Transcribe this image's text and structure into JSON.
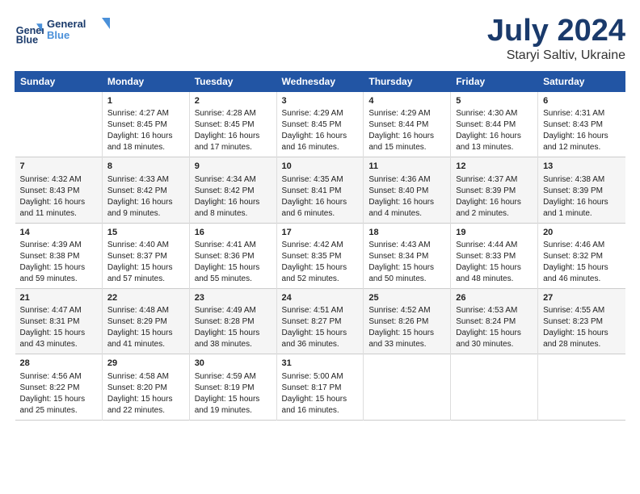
{
  "logo": {
    "line1": "General",
    "line2": "Blue"
  },
  "title": "July 2024",
  "subtitle": "Staryi Saltiv, Ukraine",
  "days_header": [
    "Sunday",
    "Monday",
    "Tuesday",
    "Wednesday",
    "Thursday",
    "Friday",
    "Saturday"
  ],
  "weeks": [
    [
      {
        "day": "",
        "content": ""
      },
      {
        "day": "1",
        "content": "Sunrise: 4:27 AM\nSunset: 8:45 PM\nDaylight: 16 hours\nand 18 minutes."
      },
      {
        "day": "2",
        "content": "Sunrise: 4:28 AM\nSunset: 8:45 PM\nDaylight: 16 hours\nand 17 minutes."
      },
      {
        "day": "3",
        "content": "Sunrise: 4:29 AM\nSunset: 8:45 PM\nDaylight: 16 hours\nand 16 minutes."
      },
      {
        "day": "4",
        "content": "Sunrise: 4:29 AM\nSunset: 8:44 PM\nDaylight: 16 hours\nand 15 minutes."
      },
      {
        "day": "5",
        "content": "Sunrise: 4:30 AM\nSunset: 8:44 PM\nDaylight: 16 hours\nand 13 minutes."
      },
      {
        "day": "6",
        "content": "Sunrise: 4:31 AM\nSunset: 8:43 PM\nDaylight: 16 hours\nand 12 minutes."
      }
    ],
    [
      {
        "day": "7",
        "content": "Sunrise: 4:32 AM\nSunset: 8:43 PM\nDaylight: 16 hours\nand 11 minutes."
      },
      {
        "day": "8",
        "content": "Sunrise: 4:33 AM\nSunset: 8:42 PM\nDaylight: 16 hours\nand 9 minutes."
      },
      {
        "day": "9",
        "content": "Sunrise: 4:34 AM\nSunset: 8:42 PM\nDaylight: 16 hours\nand 8 minutes."
      },
      {
        "day": "10",
        "content": "Sunrise: 4:35 AM\nSunset: 8:41 PM\nDaylight: 16 hours\nand 6 minutes."
      },
      {
        "day": "11",
        "content": "Sunrise: 4:36 AM\nSunset: 8:40 PM\nDaylight: 16 hours\nand 4 minutes."
      },
      {
        "day": "12",
        "content": "Sunrise: 4:37 AM\nSunset: 8:39 PM\nDaylight: 16 hours\nand 2 minutes."
      },
      {
        "day": "13",
        "content": "Sunrise: 4:38 AM\nSunset: 8:39 PM\nDaylight: 16 hours\nand 1 minute."
      }
    ],
    [
      {
        "day": "14",
        "content": "Sunrise: 4:39 AM\nSunset: 8:38 PM\nDaylight: 15 hours\nand 59 minutes."
      },
      {
        "day": "15",
        "content": "Sunrise: 4:40 AM\nSunset: 8:37 PM\nDaylight: 15 hours\nand 57 minutes."
      },
      {
        "day": "16",
        "content": "Sunrise: 4:41 AM\nSunset: 8:36 PM\nDaylight: 15 hours\nand 55 minutes."
      },
      {
        "day": "17",
        "content": "Sunrise: 4:42 AM\nSunset: 8:35 PM\nDaylight: 15 hours\nand 52 minutes."
      },
      {
        "day": "18",
        "content": "Sunrise: 4:43 AM\nSunset: 8:34 PM\nDaylight: 15 hours\nand 50 minutes."
      },
      {
        "day": "19",
        "content": "Sunrise: 4:44 AM\nSunset: 8:33 PM\nDaylight: 15 hours\nand 48 minutes."
      },
      {
        "day": "20",
        "content": "Sunrise: 4:46 AM\nSunset: 8:32 PM\nDaylight: 15 hours\nand 46 minutes."
      }
    ],
    [
      {
        "day": "21",
        "content": "Sunrise: 4:47 AM\nSunset: 8:31 PM\nDaylight: 15 hours\nand 43 minutes."
      },
      {
        "day": "22",
        "content": "Sunrise: 4:48 AM\nSunset: 8:29 PM\nDaylight: 15 hours\nand 41 minutes."
      },
      {
        "day": "23",
        "content": "Sunrise: 4:49 AM\nSunset: 8:28 PM\nDaylight: 15 hours\nand 38 minutes."
      },
      {
        "day": "24",
        "content": "Sunrise: 4:51 AM\nSunset: 8:27 PM\nDaylight: 15 hours\nand 36 minutes."
      },
      {
        "day": "25",
        "content": "Sunrise: 4:52 AM\nSunset: 8:26 PM\nDaylight: 15 hours\nand 33 minutes."
      },
      {
        "day": "26",
        "content": "Sunrise: 4:53 AM\nSunset: 8:24 PM\nDaylight: 15 hours\nand 30 minutes."
      },
      {
        "day": "27",
        "content": "Sunrise: 4:55 AM\nSunset: 8:23 PM\nDaylight: 15 hours\nand 28 minutes."
      }
    ],
    [
      {
        "day": "28",
        "content": "Sunrise: 4:56 AM\nSunset: 8:22 PM\nDaylight: 15 hours\nand 25 minutes."
      },
      {
        "day": "29",
        "content": "Sunrise: 4:58 AM\nSunset: 8:20 PM\nDaylight: 15 hours\nand 22 minutes."
      },
      {
        "day": "30",
        "content": "Sunrise: 4:59 AM\nSunset: 8:19 PM\nDaylight: 15 hours\nand 19 minutes."
      },
      {
        "day": "31",
        "content": "Sunrise: 5:00 AM\nSunset: 8:17 PM\nDaylight: 15 hours\nand 16 minutes."
      },
      {
        "day": "",
        "content": ""
      },
      {
        "day": "",
        "content": ""
      },
      {
        "day": "",
        "content": ""
      }
    ]
  ]
}
